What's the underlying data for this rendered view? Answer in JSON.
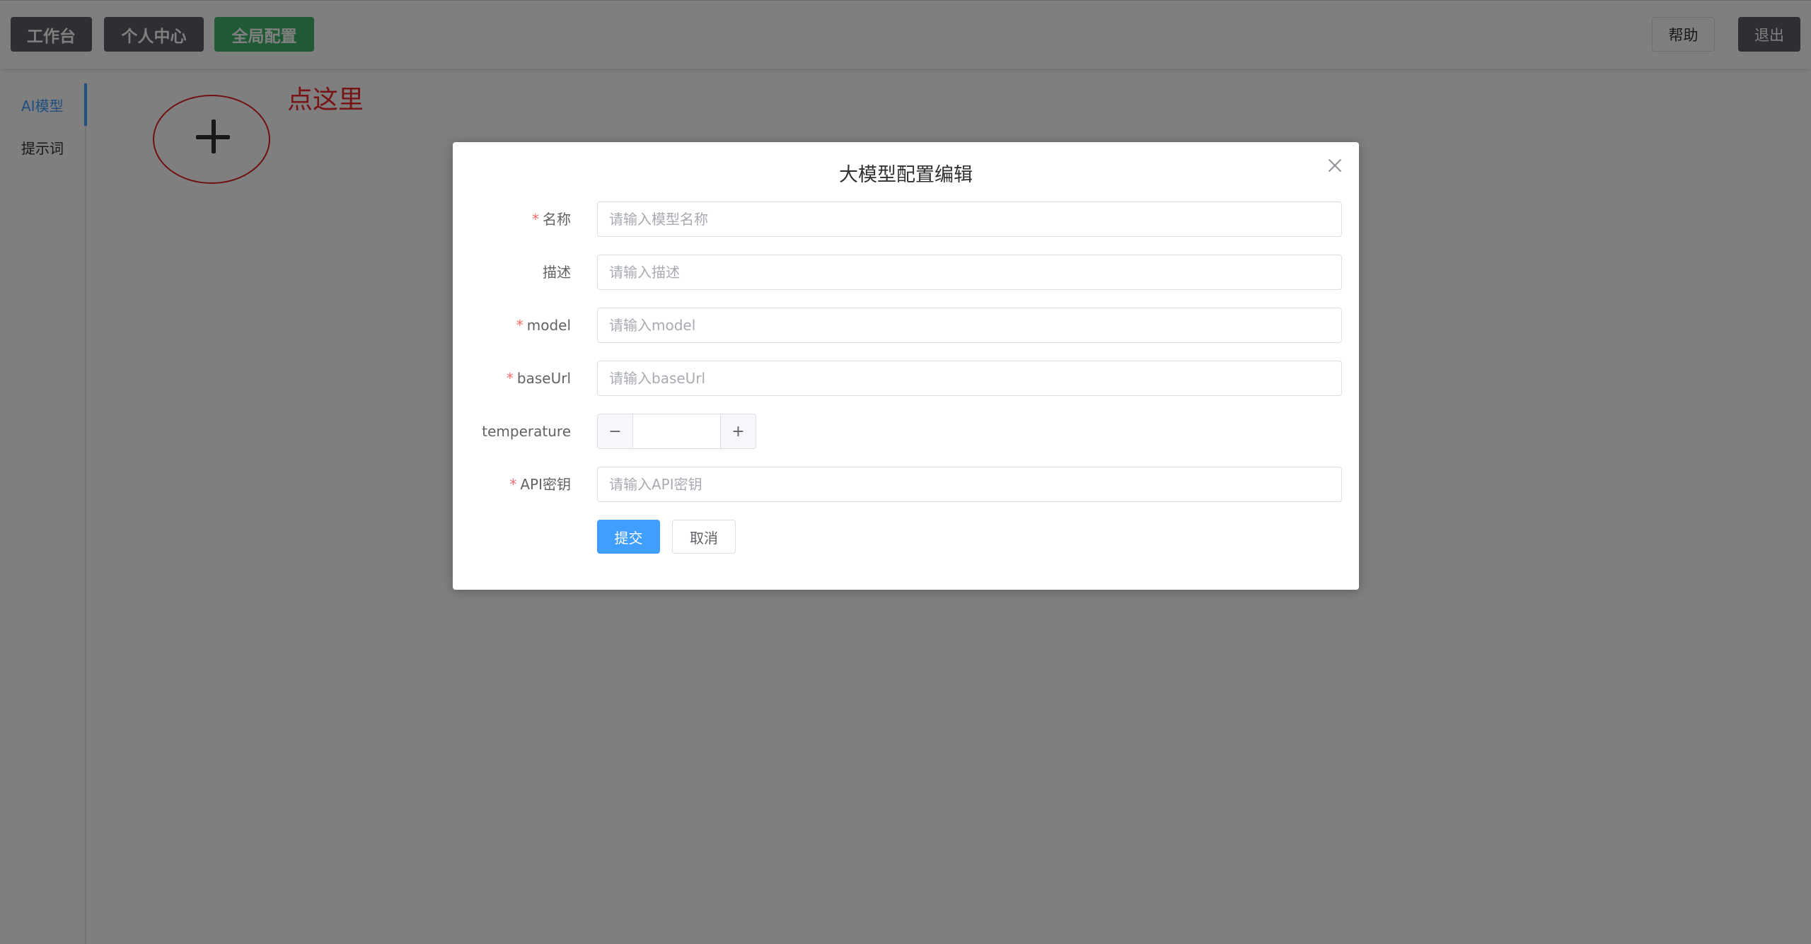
{
  "topbar": {
    "nav": [
      "工作台",
      "个人中心",
      "全局配置"
    ],
    "help_label": "帮助",
    "logout_label": "退出"
  },
  "sidebar": {
    "items": [
      {
        "label": "AI模型",
        "active": true
      },
      {
        "label": "提示词",
        "active": false
      }
    ]
  },
  "content": {
    "hint_text": "点这里"
  },
  "dialog": {
    "title": "大模型配置编辑",
    "fields": {
      "name": {
        "label": "名称",
        "required": true,
        "placeholder": "请输入模型名称",
        "value": ""
      },
      "description": {
        "label": "描述",
        "required": false,
        "placeholder": "请输入描述",
        "value": ""
      },
      "model": {
        "label": "model",
        "required": true,
        "placeholder": "请输入model",
        "value": ""
      },
      "base_url": {
        "label": "baseUrl",
        "required": true,
        "placeholder": "请输入baseUrl",
        "value": ""
      },
      "temperature": {
        "label": "temperature",
        "required": false,
        "value": "",
        "minus": "−",
        "plus": "+"
      },
      "api_key": {
        "label": "API密钥",
        "required": true,
        "placeholder": "请输入API密钥",
        "value": ""
      }
    },
    "required_mark": "*",
    "submit_label": "提交",
    "cancel_label": "取消"
  },
  "colors": {
    "accent": "#409eff",
    "active_nav": "#3fb46a",
    "dark_nav": "#5b5f66",
    "annotation": "#e02020",
    "required": "#f56c6c"
  }
}
